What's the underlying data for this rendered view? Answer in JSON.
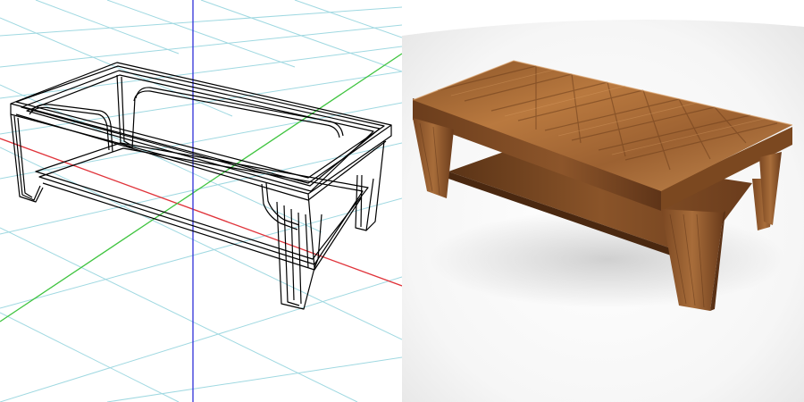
{
  "views": [
    {
      "id": "wireframe",
      "kind": "wireframe-viewport",
      "object": "coffee-table"
    },
    {
      "id": "render",
      "kind": "rendered-preview",
      "object": "coffee-table",
      "material": "walnut-herringbone"
    }
  ],
  "colors": {
    "grid": "#8fd2dc",
    "axis_x": "#e0333a",
    "axis_y": "#2f2fd8",
    "axis_z": "#3fc43f",
    "wire": "#000000",
    "wood_dark": "#6b3f1f",
    "wood_mid": "#a56a3a",
    "wood_light": "#c98d55",
    "backdrop": "#f1f1f1"
  }
}
